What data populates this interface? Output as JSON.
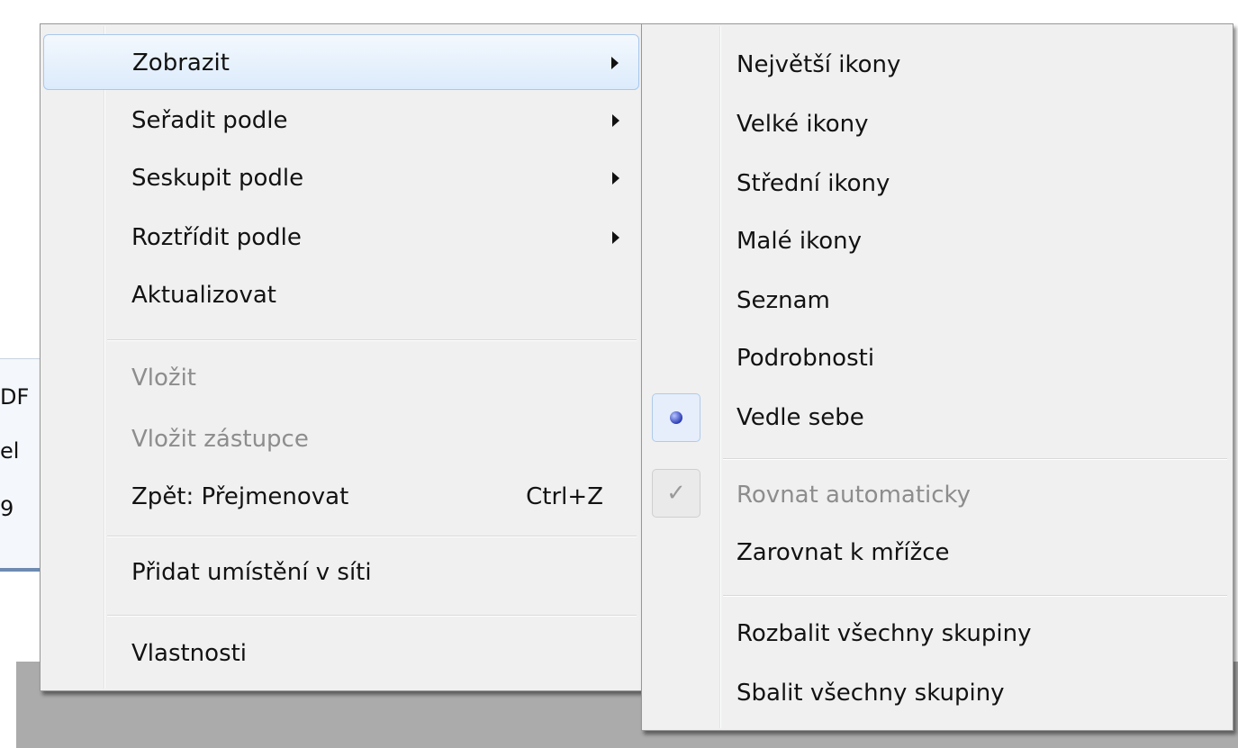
{
  "background": {
    "text_lines": [
      "DF",
      "el",
      "9"
    ]
  },
  "context_menu": {
    "items": [
      {
        "label": "Zobrazit",
        "submenu": true
      },
      {
        "label": "Seřadit podle",
        "submenu": true
      },
      {
        "label": "Seskupit podle",
        "submenu": true
      },
      {
        "label": "Roztřídit podle",
        "submenu": true
      },
      {
        "label": "Aktualizovat"
      },
      {
        "label": "Vložit",
        "disabled": true
      },
      {
        "label": "Vložit zástupce",
        "disabled": true
      },
      {
        "label": "Zpět: Přejmenovat",
        "shortcut": "Ctrl+Z"
      },
      {
        "label": "Přidat umístění v síti"
      },
      {
        "label": "Vlastnosti"
      }
    ]
  },
  "view_submenu": {
    "items": [
      {
        "label": "Největší ikony"
      },
      {
        "label": "Velké ikony"
      },
      {
        "label": "Střední ikony"
      },
      {
        "label": "Malé ikony"
      },
      {
        "label": "Seznam"
      },
      {
        "label": "Podrobnosti"
      },
      {
        "label": "Vedle sebe",
        "selected": true
      },
      {
        "label": "Rovnat automaticky",
        "disabled": true,
        "checked": true
      },
      {
        "label": "Zarovnat k mřížce"
      },
      {
        "label": "Rozbalit všechny skupiny"
      },
      {
        "label": "Sbalit všechny skupiny"
      }
    ],
    "check_glyph": "✓"
  },
  "colors": {
    "menu_bg": "#f0f0f0",
    "highlight_border": "#a8c8ec",
    "disabled_text": "#8d8d8d",
    "radio_dot": "#2c3cb5"
  }
}
